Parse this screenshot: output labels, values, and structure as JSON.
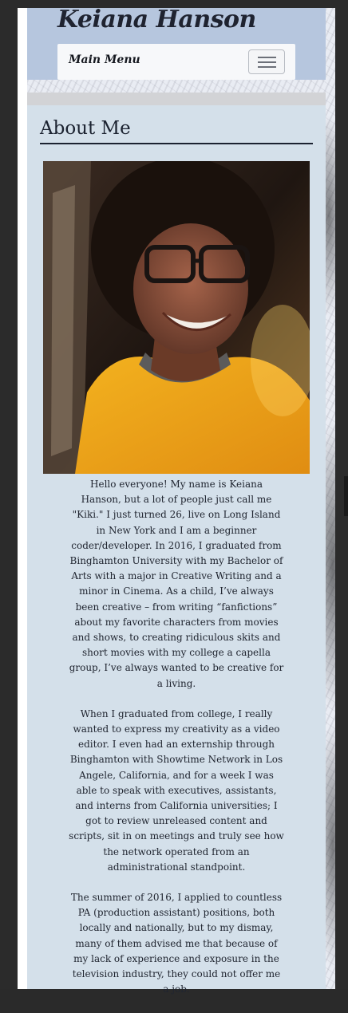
{
  "header": {
    "site_title": "Keiana Hanson",
    "menu_label": "Main Menu",
    "menu_toggle_icon": "hamburger-icon"
  },
  "about": {
    "heading": "About Me",
    "photo_alt": "Portrait of Keiana Hanson smiling, wearing glasses and a yellow top",
    "paragraphs": [
      "Hello everyone! My name is Keiana Hanson, but a lot of people just call me \"Kiki.\" I just turned 26, live on Long Island in New York and I am a beginner coder/developer. In 2016, I graduated from Binghamton University with my Bachelor of Arts with a major in Creative Writing and a minor in Cinema. As a child, I’ve always been creative – from writing “fanfictions” about my favorite characters from movies and shows, to creating ridiculous skits and short movies with my college a capella group, I’ve always wanted to be creative for a living.",
      "When I graduated from college, I really wanted to express my creativity as a video editor. I even had an externship through Binghamton with Showtime Network in Los Angele, California, and for a week I was able to speak with executives, assistants, and interns from California universities; I got to review unreleased content and scripts, sit in on meetings and truly see how the network operated from an administrational standpoint.",
      "The summer of 2016, I applied to countless PA (production assistant) positions, both locally and nationally, but to my dismay, many of them advised me that because of my lack of experience and exposure in the television industry, they could not offer me a job."
    ]
  },
  "colors": {
    "header_bg": "#b6c6de",
    "content_bg": "#d4e0ea",
    "text": "#202530"
  }
}
